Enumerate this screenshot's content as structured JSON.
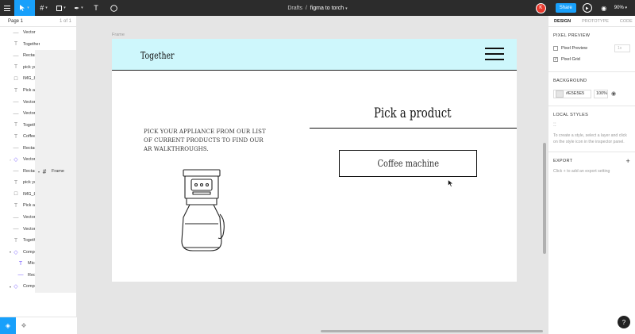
{
  "topbar": {
    "crumb_drafts": "Drafts",
    "crumb_sep": "/",
    "file_name": "figma to torch",
    "avatar_initial": "K",
    "share_label": "Share",
    "zoom": "90%"
  },
  "left": {
    "page_name": "Page 1",
    "page_count": "1 of 1",
    "layers": [
      {
        "label": "Frame",
        "type": "frame",
        "icon": "frame-icon"
      },
      {
        "label": "Vector",
        "type": "child",
        "icon": "vector-icon"
      },
      {
        "label": "Together",
        "type": "child",
        "icon": "text-icon"
      },
      {
        "label": "Rectangle",
        "type": "child",
        "icon": "rectangle-icon"
      },
      {
        "label": "Frame",
        "type": "frame",
        "icon": "frame-icon"
      },
      {
        "label": "pick your appliance from ...",
        "type": "child",
        "icon": "text-icon"
      },
      {
        "label": "IMG_8704",
        "type": "child",
        "icon": "image-icon"
      },
      {
        "label": "Pick a product",
        "type": "child",
        "icon": "text-icon"
      },
      {
        "label": "Vector 2",
        "type": "child",
        "icon": "vector-icon"
      },
      {
        "label": "Vector",
        "type": "child",
        "icon": "vector-icon"
      },
      {
        "label": "Together",
        "type": "child",
        "icon": "text-icon"
      },
      {
        "label": "Coffee machine",
        "type": "child",
        "icon": "text-icon"
      },
      {
        "label": "Rectangle",
        "type": "child",
        "icon": "rectangle-icon"
      },
      {
        "label": "Vector",
        "type": "component",
        "icon": "component-icon"
      },
      {
        "label": "Rectangle",
        "type": "child",
        "icon": "rectangle-icon"
      },
      {
        "label": "Frame",
        "type": "frame",
        "icon": "frame-icon"
      },
      {
        "label": "pick your appliance from ...",
        "type": "child",
        "icon": "text-icon"
      },
      {
        "label": "IMG_8704",
        "type": "child",
        "icon": "image-icon"
      },
      {
        "label": "Pick a product",
        "type": "child",
        "icon": "text-icon"
      },
      {
        "label": "Vector 2",
        "type": "child",
        "icon": "vector-icon"
      },
      {
        "label": "Vector",
        "type": "child",
        "icon": "vector-icon"
      },
      {
        "label": "Together",
        "type": "child",
        "icon": "text-icon"
      },
      {
        "label": "Component",
        "type": "component-open",
        "icon": "component-icon"
      },
      {
        "label": "Microwave oven",
        "type": "grandchild",
        "icon": "text-icon"
      },
      {
        "label": "Rectangle",
        "type": "grandchild",
        "icon": "rectangle-icon"
      },
      {
        "label": "Component",
        "type": "component-open",
        "icon": "component-icon"
      }
    ]
  },
  "canvas": {
    "frame_label": "Frame",
    "brand": "Together",
    "description": "PICK YOUR APPLIANCE FROM OUR LIST OF CURRENT PRODUCTS TO FIND OUR AR WALKTHROUGHS.",
    "heading": "Pick a product",
    "product_button": "Coffee machine",
    "header_color": "#cef7fc"
  },
  "right": {
    "tabs": [
      "DESIGN",
      "PROTOTYPE",
      "CODE"
    ],
    "pixel_preview_title": "PIXEL PREVIEW",
    "pixel_preview_label": "Pixel Preview",
    "pixel_preview_select": "1x",
    "pixel_grid_label": "Pixel Grid",
    "background_title": "BACKGROUND",
    "bg_hex": "#E5E5E5",
    "bg_opacity": "100%",
    "local_styles_title": "LOCAL STYLES",
    "local_styles_hint": "To create a style, select a layer and click on the style icon in the inspector panel.",
    "export_title": "EXPORT",
    "export_hint": "Click + to add an export setting"
  },
  "help_label": "?"
}
